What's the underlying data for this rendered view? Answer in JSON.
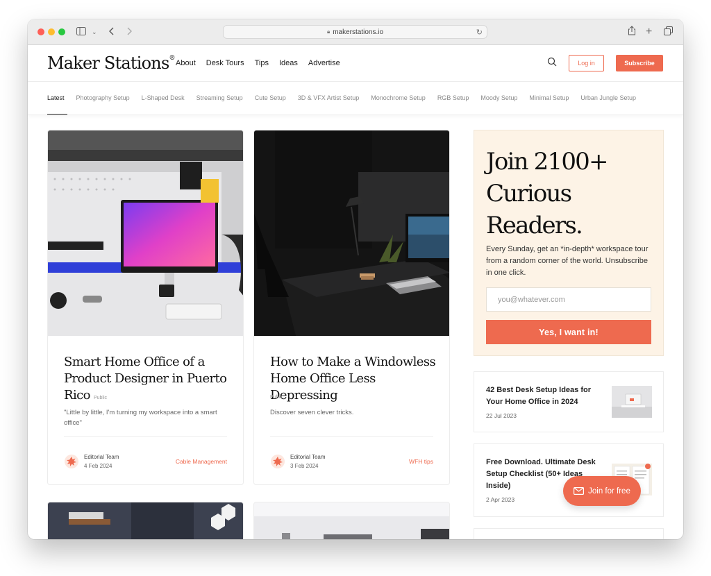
{
  "browser": {
    "url": "makerstations.io"
  },
  "site": {
    "logo": "Maker Stations",
    "logo_mark": "®",
    "nav": [
      "About",
      "Desk Tours",
      "Tips",
      "Ideas",
      "Advertise"
    ],
    "login_label": "Log in",
    "subscribe_label": "Subscribe"
  },
  "categories": [
    "Latest",
    "Photography Setup",
    "L-Shaped Desk",
    "Streaming Setup",
    "Cute Setup",
    "3D & VFX Artist Setup",
    "Monochrome Setup",
    "RGB Setup",
    "Moody Setup",
    "Minimal Setup",
    "Urban Jungle Setup"
  ],
  "posts": [
    {
      "title": "Smart Home Office of a Product Designer in Puerto Rico",
      "tag": "Public",
      "excerpt": "\"Little by little, I'm turning my workspace into a smart office\"",
      "author": "Editorial Team",
      "date": "4 Feb 2024",
      "category": "Cable Management"
    },
    {
      "title": "How to Make a Windowless Home Office Less Depressing",
      "tag": "Public",
      "excerpt": "Discover seven clever tricks.",
      "author": "Editorial Team",
      "date": "3 Feb 2024",
      "category": "WFH tips"
    }
  ],
  "signup": {
    "heading": "Join 2100+ Curious Readers.",
    "description": "Every Sunday, get an *in-depth* workspace tour from a random corner of the world. Unsubscribe in one click.",
    "email_placeholder": "you@whatever.com",
    "cta": "Yes, I want in!"
  },
  "side_posts": [
    {
      "title": "42 Best Desk Setup Ideas for Your Home Office in 2024",
      "date": "22 Jul 2023"
    },
    {
      "title": "Free Download. Ultimate Desk Setup Checklist (50+ Ideas Inside)",
      "date": "2 Apr 2023"
    }
  ],
  "join_button": "Join for free",
  "colors": {
    "accent": "#ee6a4f",
    "signup_bg": "#fdf3e6"
  }
}
